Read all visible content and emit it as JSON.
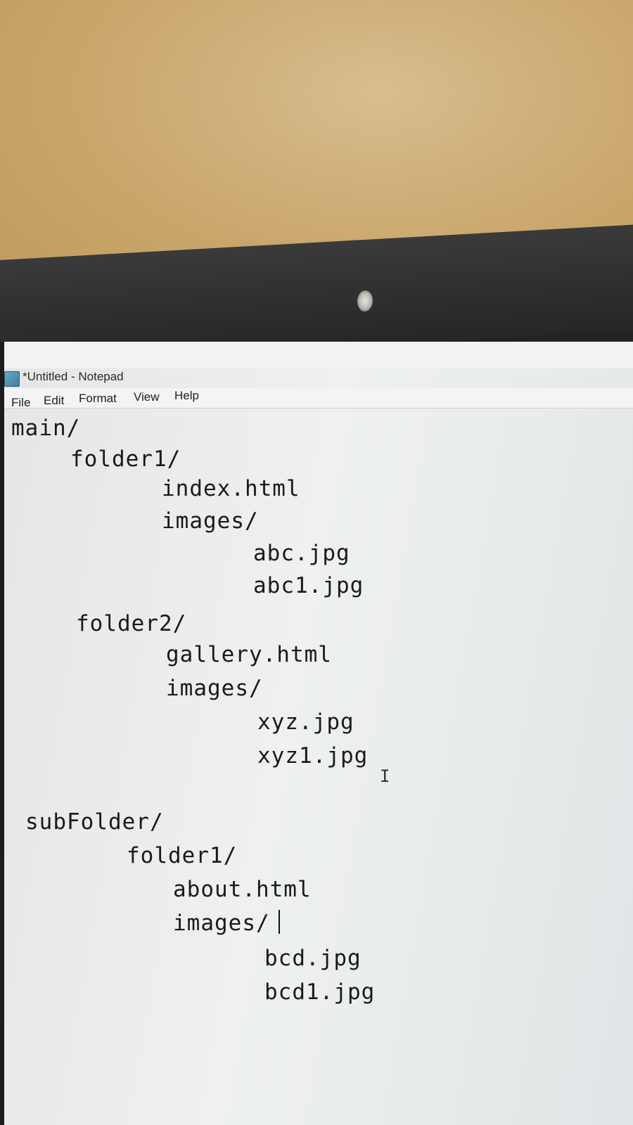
{
  "window": {
    "title": "*Untitled - Notepad"
  },
  "menu": {
    "items": [
      "File",
      "Edit",
      "Format",
      "View",
      "Help"
    ]
  },
  "document": {
    "lines": [
      "main/",
      "folder1/",
      "index.html",
      "images/",
      "abc.jpg",
      "abc1.jpg",
      "folder2/",
      "gallery.html",
      "images/",
      "xyz.jpg",
      "xyz1.jpg",
      "subFolder/",
      "folder1/",
      "about.html",
      "images/",
      "bcd.jpg",
      "bcd1.jpg"
    ]
  },
  "colors": {
    "wall": "#c9a66c",
    "bezel": "#232323",
    "screen": "#eceeef",
    "text": "#1a1a1a"
  },
  "icons": {
    "app": "notepad-icon",
    "cursor": "ibeam-cursor-icon"
  }
}
